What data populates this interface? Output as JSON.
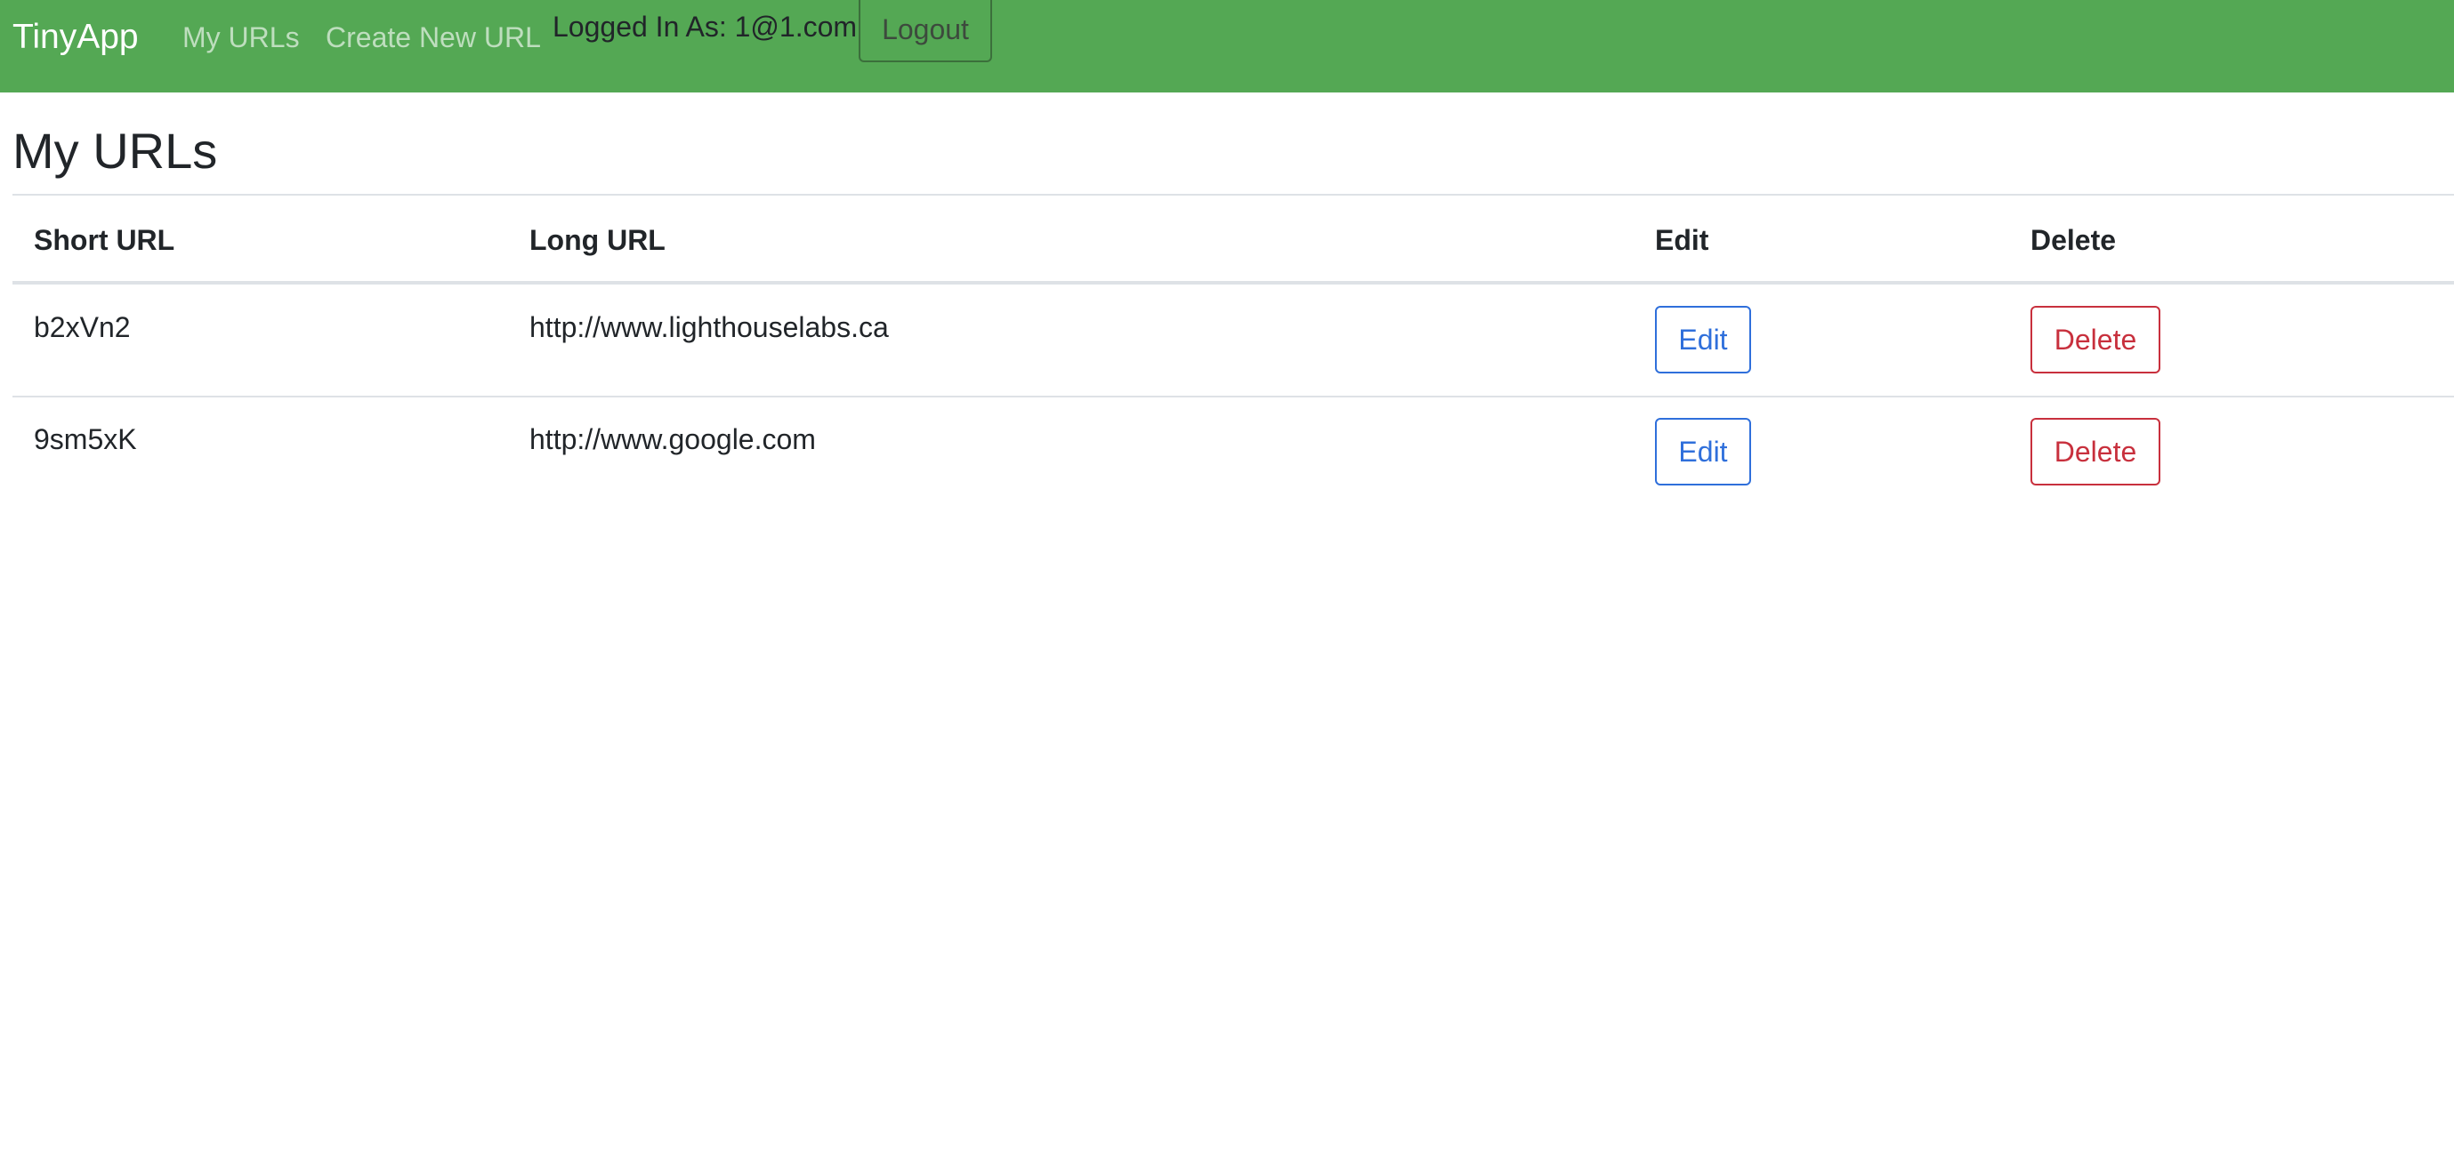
{
  "navbar": {
    "brand": "TinyApp",
    "links": [
      "My URLs",
      "Create New URL"
    ],
    "logged_in_text": "Logged In As: 1@1.com",
    "logout_label": "Logout",
    "background_color": "#54a854"
  },
  "main": {
    "title": "My URLs",
    "table": {
      "headers": [
        "Short URL",
        "Long URL",
        "Edit",
        "Delete"
      ],
      "rows": [
        {
          "short_url": "b2xVn2",
          "long_url": "http://www.lighthouselabs.ca",
          "edit_label": "Edit",
          "delete_label": "Delete"
        },
        {
          "short_url": "9sm5xK",
          "long_url": "http://www.google.com",
          "edit_label": "Edit",
          "delete_label": "Delete"
        }
      ]
    }
  },
  "colors": {
    "edit_outline": "#2f6fdb",
    "delete_outline": "#c8303d"
  }
}
